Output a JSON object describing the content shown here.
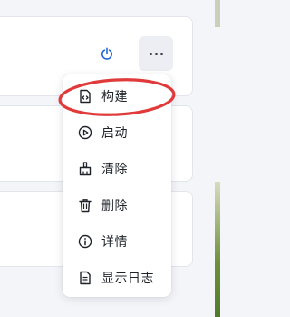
{
  "colors": {
    "accent": "#1e64d8",
    "annotation": "#e03a3a",
    "text": "#1f2329"
  },
  "card": {
    "power_icon": "power-icon",
    "more_icon": "more-horizontal-icon"
  },
  "menu": {
    "items": [
      {
        "label": "构建",
        "icon": "build-code-file-icon"
      },
      {
        "label": "启动",
        "icon": "play-circle-icon"
      },
      {
        "label": "清除",
        "icon": "clear-broom-icon"
      },
      {
        "label": "删除",
        "icon": "trash-icon"
      },
      {
        "label": "详情",
        "icon": "info-circle-icon"
      },
      {
        "label": "显示日志",
        "icon": "log-file-icon"
      }
    ]
  }
}
